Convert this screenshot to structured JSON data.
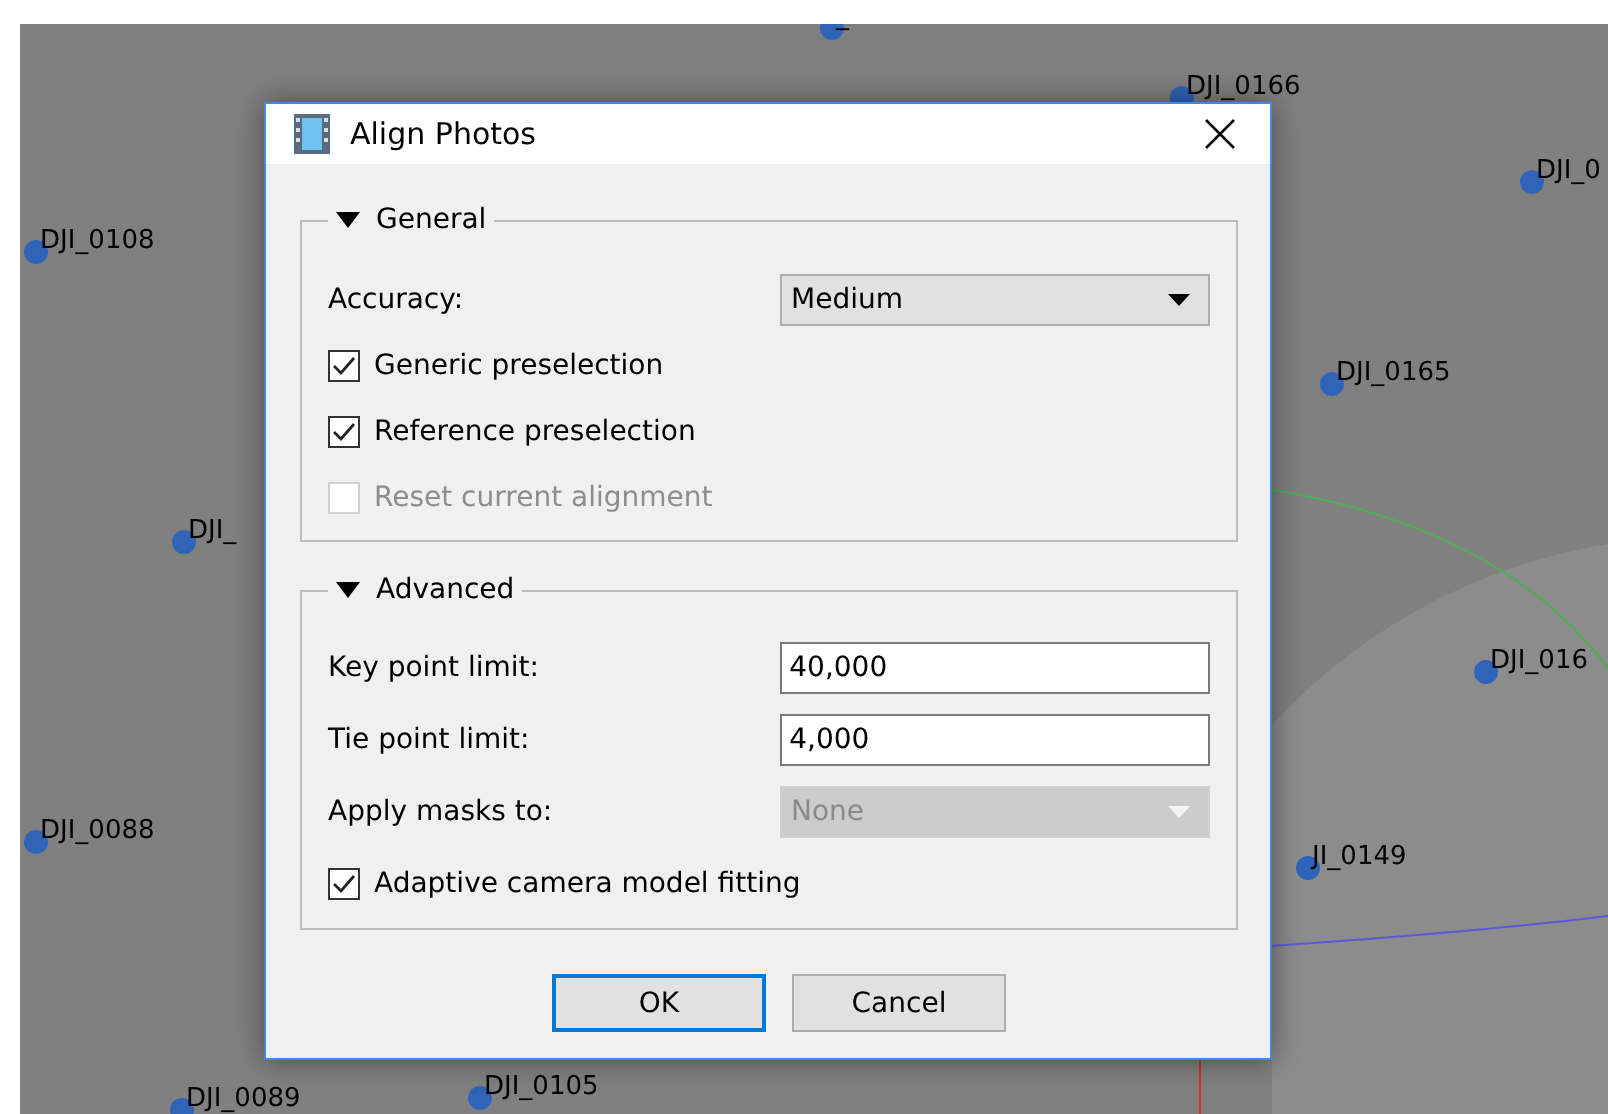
{
  "viewport": {
    "cameras": [
      {
        "label": "_"
      },
      {
        "label": "DJI_0166"
      },
      {
        "label": "DJI_0"
      },
      {
        "label": "DJI_0108"
      },
      {
        "label": "DJI_"
      },
      {
        "label": "DJI_0165"
      },
      {
        "label": "DJI_016"
      },
      {
        "label": "DJI_0088"
      },
      {
        "label": "JI_0149"
      },
      {
        "label": "DJI_0089"
      },
      {
        "label": "DJI_0105"
      }
    ]
  },
  "dialog": {
    "title": "Align Photos",
    "groups": [
      {
        "title": "General",
        "expanded": true,
        "rows": [
          {
            "kind": "combo",
            "label": "Accuracy:",
            "value": "Medium",
            "disabled": false
          },
          {
            "kind": "checkbox",
            "label": "Generic preselection",
            "checked": true,
            "disabled": false
          },
          {
            "kind": "checkbox",
            "label": "Reference preselection",
            "checked": true,
            "disabled": false
          },
          {
            "kind": "checkbox",
            "label": "Reset current alignment",
            "checked": false,
            "disabled": true
          }
        ]
      },
      {
        "title": "Advanced",
        "expanded": true,
        "rows": [
          {
            "kind": "input",
            "label": "Key point limit:",
            "value": "40,000"
          },
          {
            "kind": "input",
            "label": "Tie point limit:",
            "value": "4,000"
          },
          {
            "kind": "combo",
            "label": "Apply masks to:",
            "value": "None",
            "disabled": true
          },
          {
            "kind": "checkbox",
            "label": "Adaptive camera model fitting",
            "checked": true,
            "disabled": false
          }
        ]
      }
    ],
    "buttons": [
      {
        "label": "OK",
        "default": true
      },
      {
        "label": "Cancel",
        "default": false
      }
    ]
  }
}
